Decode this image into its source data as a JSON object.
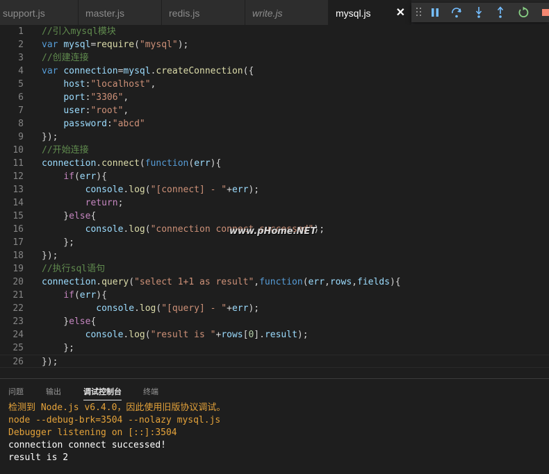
{
  "tabs": [
    {
      "label": "support.js",
      "italic": false,
      "active": false
    },
    {
      "label": "master.js",
      "italic": false,
      "active": false
    },
    {
      "label": "redis.js",
      "italic": false,
      "active": false
    },
    {
      "label": "write.js",
      "italic": true,
      "active": false
    },
    {
      "label": "mysql.js",
      "italic": false,
      "active": true
    }
  ],
  "close_glyph": "✕",
  "debug_toolbar": {
    "buttons": [
      "pause-icon",
      "step-over-icon",
      "step-into-icon",
      "step-out-icon",
      "restart-icon",
      "stop-icon"
    ],
    "colors": {
      "pause": "#75beff",
      "restart": "#89d185",
      "stop": "#f48771"
    }
  },
  "editor": {
    "lines": [
      {
        "n": "1",
        "tokens": [
          [
            "c",
            "//引入mysql模块"
          ]
        ]
      },
      {
        "n": "2",
        "tokens": [
          [
            "k",
            "var "
          ],
          [
            "v",
            "mysql"
          ],
          [
            "p",
            "="
          ],
          [
            "f",
            "require"
          ],
          [
            "p",
            "("
          ],
          [
            "s",
            "\"mysql\""
          ],
          [
            "p",
            ");"
          ]
        ]
      },
      {
        "n": "3",
        "tokens": [
          [
            "c",
            "//创建连接"
          ]
        ]
      },
      {
        "n": "4",
        "tokens": [
          [
            "k",
            "var "
          ],
          [
            "v",
            "connection"
          ],
          [
            "p",
            "="
          ],
          [
            "v",
            "mysql"
          ],
          [
            "p",
            "."
          ],
          [
            "f",
            "createConnection"
          ],
          [
            "p",
            "({"
          ]
        ]
      },
      {
        "n": "5",
        "tokens": [
          [
            "p",
            "    "
          ],
          [
            "v",
            "host"
          ],
          [
            "p",
            ":"
          ],
          [
            "s",
            "\"localhost\""
          ],
          [
            "p",
            ","
          ]
        ]
      },
      {
        "n": "6",
        "tokens": [
          [
            "p",
            "    "
          ],
          [
            "v",
            "port"
          ],
          [
            "p",
            ":"
          ],
          [
            "s",
            "\"3306\""
          ],
          [
            "p",
            ","
          ]
        ]
      },
      {
        "n": "7",
        "tokens": [
          [
            "p",
            "    "
          ],
          [
            "v",
            "user"
          ],
          [
            "p",
            ":"
          ],
          [
            "s",
            "\"root\""
          ],
          [
            "p",
            ","
          ]
        ]
      },
      {
        "n": "8",
        "tokens": [
          [
            "p",
            "    "
          ],
          [
            "v",
            "password"
          ],
          [
            "p",
            ":"
          ],
          [
            "s",
            "\"abcd\""
          ]
        ]
      },
      {
        "n": "9",
        "tokens": [
          [
            "p",
            "});"
          ]
        ]
      },
      {
        "n": "10",
        "tokens": [
          [
            "c",
            "//开始连接"
          ]
        ]
      },
      {
        "n": "11",
        "tokens": [
          [
            "v",
            "connection"
          ],
          [
            "p",
            "."
          ],
          [
            "f",
            "connect"
          ],
          [
            "p",
            "("
          ],
          [
            "k",
            "function"
          ],
          [
            "p",
            "("
          ],
          [
            "v",
            "err"
          ],
          [
            "p",
            "){"
          ]
        ]
      },
      {
        "n": "12",
        "tokens": [
          [
            "p",
            "    "
          ],
          [
            "x",
            "if"
          ],
          [
            "p",
            "("
          ],
          [
            "v",
            "err"
          ],
          [
            "p",
            "){"
          ]
        ]
      },
      {
        "n": "13",
        "tokens": [
          [
            "p",
            "        "
          ],
          [
            "v",
            "console"
          ],
          [
            "p",
            "."
          ],
          [
            "f",
            "log"
          ],
          [
            "p",
            "("
          ],
          [
            "s",
            "\"[connect] - \""
          ],
          [
            "p",
            "+"
          ],
          [
            "v",
            "err"
          ],
          [
            "p",
            ");"
          ]
        ]
      },
      {
        "n": "14",
        "tokens": [
          [
            "p",
            "        "
          ],
          [
            "x",
            "return"
          ],
          [
            "p",
            ";"
          ]
        ]
      },
      {
        "n": "15",
        "tokens": [
          [
            "p",
            "    }"
          ],
          [
            "x",
            "else"
          ],
          [
            "p",
            "{"
          ]
        ]
      },
      {
        "n": "16",
        "tokens": [
          [
            "p",
            "        "
          ],
          [
            "v",
            "console"
          ],
          [
            "p",
            "."
          ],
          [
            "f",
            "log"
          ],
          [
            "p",
            "("
          ],
          [
            "s",
            "\"connection connect successed\""
          ],
          [
            "p",
            ");"
          ]
        ]
      },
      {
        "n": "17",
        "tokens": [
          [
            "p",
            "    };"
          ]
        ]
      },
      {
        "n": "18",
        "tokens": [
          [
            "p",
            "});"
          ]
        ]
      },
      {
        "n": "19",
        "tokens": [
          [
            "c",
            "//执行sql语句"
          ]
        ]
      },
      {
        "n": "20",
        "tokens": [
          [
            "v",
            "connection"
          ],
          [
            "p",
            "."
          ],
          [
            "f",
            "query"
          ],
          [
            "p",
            "("
          ],
          [
            "s",
            "\"select 1+1 as result\""
          ],
          [
            "p",
            ","
          ],
          [
            "k",
            "function"
          ],
          [
            "p",
            "("
          ],
          [
            "v",
            "err"
          ],
          [
            "p",
            ","
          ],
          [
            "v",
            "rows"
          ],
          [
            "p",
            ","
          ],
          [
            "v",
            "fields"
          ],
          [
            "p",
            "){"
          ]
        ]
      },
      {
        "n": "21",
        "tokens": [
          [
            "p",
            "    "
          ],
          [
            "x",
            "if"
          ],
          [
            "p",
            "("
          ],
          [
            "v",
            "err"
          ],
          [
            "p",
            "){"
          ]
        ]
      },
      {
        "n": "22",
        "tokens": [
          [
            "p",
            "          "
          ],
          [
            "v",
            "console"
          ],
          [
            "p",
            "."
          ],
          [
            "f",
            "log"
          ],
          [
            "p",
            "("
          ],
          [
            "s",
            "\"[query] - \""
          ],
          [
            "p",
            "+"
          ],
          [
            "v",
            "err"
          ],
          [
            "p",
            ");"
          ]
        ]
      },
      {
        "n": "23",
        "tokens": [
          [
            "p",
            "    }"
          ],
          [
            "x",
            "else"
          ],
          [
            "p",
            "{"
          ]
        ]
      },
      {
        "n": "24",
        "tokens": [
          [
            "p",
            "        "
          ],
          [
            "v",
            "console"
          ],
          [
            "p",
            "."
          ],
          [
            "f",
            "log"
          ],
          [
            "p",
            "("
          ],
          [
            "s",
            "\"result is \""
          ],
          [
            "p",
            "+"
          ],
          [
            "v",
            "rows"
          ],
          [
            "p",
            "["
          ],
          [
            "n",
            "0"
          ],
          [
            "p",
            "]."
          ],
          [
            "v",
            "result"
          ],
          [
            "p",
            ");"
          ]
        ]
      },
      {
        "n": "25",
        "tokens": [
          [
            "p",
            "    };"
          ]
        ]
      },
      {
        "n": "26",
        "tokens": [
          [
            "p",
            "});"
          ]
        ]
      }
    ]
  },
  "watermark": "www.pHome.NET",
  "panel": {
    "tabs": [
      {
        "label": "问题",
        "active": false
      },
      {
        "label": "输出",
        "active": false
      },
      {
        "label": "调试控制台",
        "active": true
      },
      {
        "label": "终端",
        "active": false
      }
    ],
    "output": [
      {
        "text": "检测到 Node.js v6.4.0，因此使用旧版协议调试。",
        "kind": "warn"
      },
      {
        "text": "node --debug-brk=3504 --nolazy mysql.js",
        "kind": "warn"
      },
      {
        "text": "Debugger listening on [::]:3504",
        "kind": "warn"
      },
      {
        "text": "connection connect successed!",
        "kind": "info"
      },
      {
        "text": "result is 2",
        "kind": "info"
      }
    ]
  }
}
